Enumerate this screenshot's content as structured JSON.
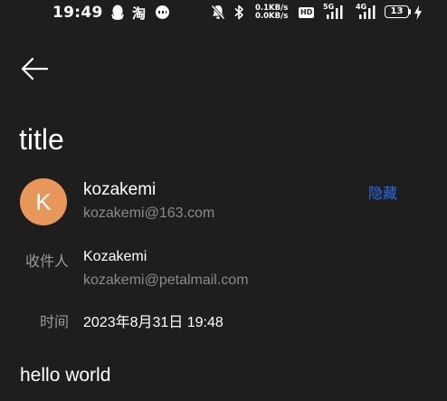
{
  "status_bar": {
    "time": "19:49",
    "taobao_glyph": "淘",
    "net_speed_up": "0.1KB/s",
    "net_speed_down": "0.0KB/s",
    "hd_label": "HD",
    "signal1_label": "5G",
    "signal2_label": "4G",
    "battery_level": "13",
    "icons": [
      "qq-icon",
      "taobao-icon",
      "chat-bubble-icon",
      "mute-icon",
      "bluetooth-icon",
      "hd-icon",
      "signal-icon",
      "signal-icon",
      "battery-icon",
      "charging-icon"
    ]
  },
  "header": {
    "back_icon": "arrow-left-icon"
  },
  "email": {
    "title": "title",
    "sender": {
      "avatar_letter": "K",
      "avatar_color": "#e8975b",
      "name": "kozakemi",
      "email": "kozakemi@163.com"
    },
    "hide_label": "隐藏",
    "recipient_label": "收件人",
    "recipient_name": "Kozakemi",
    "recipient_email": "kozakemi@petalmail.com",
    "time_label": "时间",
    "time_value": "2023年8月31日 19:48",
    "body": "hello world"
  },
  "colors": {
    "background": "#1e1e1e",
    "accent_link": "#2a6ce6",
    "secondary_text": "#8a8a8a"
  }
}
